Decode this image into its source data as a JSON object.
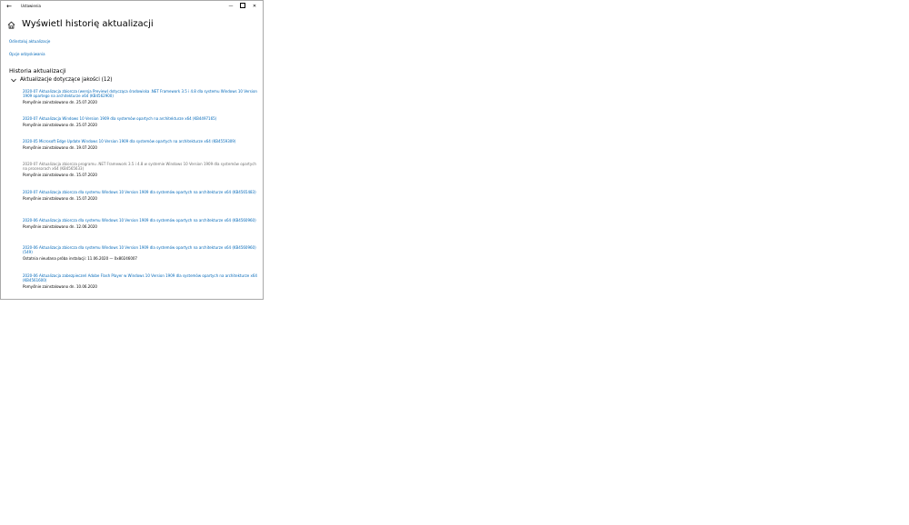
{
  "window": {
    "app_title": "Ustawienia",
    "back_glyph": "←",
    "minimize_glyph": "—",
    "close_glyph": "✕"
  },
  "page": {
    "title": "Wyświetl historię aktualizacji",
    "uninstall_link": "Odinstaluj aktualizacje",
    "recovery_link": "Opcje odzyskiwania",
    "section_title": "Historia aktualizacji",
    "group_label": "Aktualizacje dotyczące jakości (12)"
  },
  "updates": [
    {
      "title": "2020-07 Aktualizacja zbiorcza (wersja Preview) dotycząca środowiska .NET Framework 3.5 i 4.8 dla systemu Windows 10 Version 1909 opartego na architekturze x64 (KB4562900)",
      "status": "Pomyślnie zainstalowano dn. 25.07.2020",
      "dimmed": false
    },
    {
      "title": "2020-07 Aktualizacja Windows 10 Version 1909 dla systemów opartych na architekturze x64 (KB4497165)",
      "status": "Pomyślnie zainstalowano dn. 25.07.2020",
      "dimmed": false
    },
    {
      "title": "2020-05 Microsoft Edge Update Windows 10 Version 1909 dla systemów opartych na architekturze x64 (KB4559309)",
      "status": "Pomyślnie zainstalowano dn. 19.07.2020",
      "dimmed": false
    },
    {
      "title": "2020-07 Aktualizacja zbiorcza programu .NET Framework 3.5 i 4.8 w systemie Windows 10 Version 1909 dla systemów opartych na procesorach x64 (KB4565633)",
      "status": "Pomyślnie zainstalowano dn. 15.07.2020",
      "dimmed": true
    },
    {
      "title": "2020-07 Aktualizacja zbiorcza dla systemu Windows 10 Version 1909 dla systemów opartych na architekturze x64 (KB4565483)",
      "status": "Pomyślnie zainstalowano dn. 15.07.2020",
      "dimmed": false
    },
    {
      "title": "2020-06 Aktualizacja zbiorcza dla systemu Windows 10 Version 1909 dla systemów opartych na architekturze x64 (KB4560960)",
      "status": "Pomyślnie zainstalowano dn. 12.06.2020",
      "dimmed": false
    },
    {
      "title": "2020-06 Aktualizacja zbiorcza dla systemu Windows 10 Version 1909 dla systemów opartych na architekturze x64 (KB4560960) (549)",
      "status": "Ostatnia nieudana próba instalacji: 11.06.2020 — 0x80246007",
      "dimmed": false
    },
    {
      "title": "2020-06 Aktualizacja zabezpieczeń Adobe Flash Player w Windows 10 Version 1909 dla systemów opartych na architekturze x64 (KB4561600)",
      "status": "Pomyślnie zainstalowano dn. 10.06.2020",
      "dimmed": false
    }
  ]
}
